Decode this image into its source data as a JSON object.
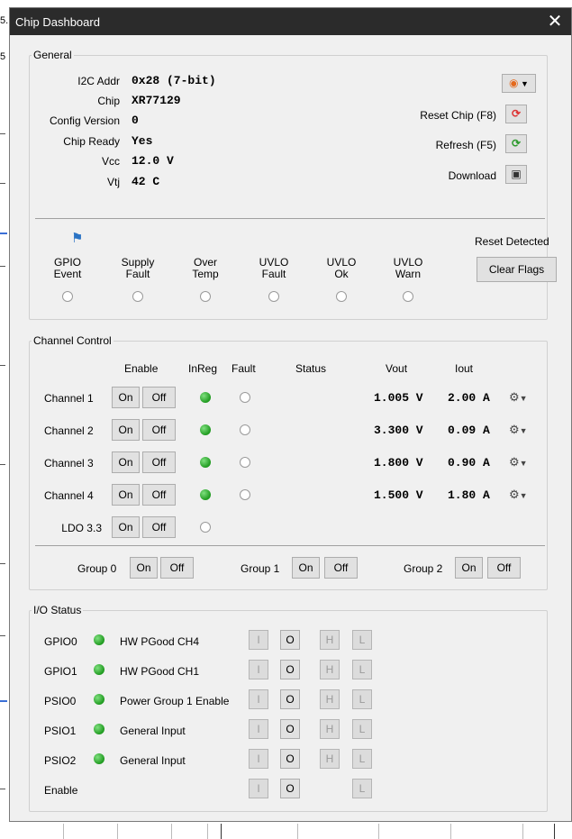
{
  "window": {
    "title": "Chip Dashboard"
  },
  "general": {
    "legend": "General",
    "fields": [
      {
        "label": "I2C Addr",
        "value": "0x28 (7-bit)"
      },
      {
        "label": "Chip",
        "value": "XR77129"
      },
      {
        "label": "Config Version",
        "value": "0"
      },
      {
        "label": "Chip Ready",
        "value": "Yes"
      },
      {
        "label": "Vcc",
        "value": "12.0 V"
      },
      {
        "label": "Vtj",
        "value": "42 C"
      }
    ],
    "reset_chip_label": "Reset Chip (F8)",
    "refresh_label": "Refresh (F5)",
    "download_label": "Download",
    "flags": [
      {
        "line1": "GPIO",
        "line2": "Event"
      },
      {
        "line1": "Supply",
        "line2": "Fault"
      },
      {
        "line1": "Over",
        "line2": "Temp"
      },
      {
        "line1": "UVLO",
        "line2": "Fault"
      },
      {
        "line1": "UVLO",
        "line2": "Ok"
      },
      {
        "line1": "UVLO",
        "line2": "Warn"
      }
    ],
    "reset_detected": "Reset Detected",
    "clear_flags": "Clear Flags"
  },
  "channel_control": {
    "legend": "Channel Control",
    "headers": {
      "enable": "Enable",
      "inreg": "InReg",
      "fault": "Fault",
      "status": "Status",
      "vout": "Vout",
      "iout": "Iout"
    },
    "on_label": "On",
    "off_label": "Off",
    "channels": [
      {
        "name": "Channel 1",
        "vout": "1.005 V",
        "iout": "2.00 A"
      },
      {
        "name": "Channel 2",
        "vout": "3.300 V",
        "iout": "0.09 A"
      },
      {
        "name": "Channel 3",
        "vout": "1.800 V",
        "iout": "0.90 A"
      },
      {
        "name": "Channel 4",
        "vout": "1.500 V",
        "iout": "1.80 A"
      }
    ],
    "ldo": {
      "name": "LDO 3.3"
    },
    "groups": [
      {
        "name": "Group 0"
      },
      {
        "name": "Group 1"
      },
      {
        "name": "Group 2"
      }
    ]
  },
  "io_status": {
    "legend": "I/O Status",
    "btn_labels": {
      "i": "I",
      "o": "O",
      "h": "H",
      "l": "L"
    },
    "rows": [
      {
        "name": "GPIO0",
        "desc": "HW PGood CH4"
      },
      {
        "name": "GPIO1",
        "desc": "HW PGood CH1"
      },
      {
        "name": "PSIO0",
        "desc": "Power Group 1 Enable"
      },
      {
        "name": "PSIO1",
        "desc": "General Input"
      },
      {
        "name": "PSIO2",
        "desc": "General Input"
      },
      {
        "name": "Enable",
        "desc": ""
      }
    ]
  },
  "background": {
    "left_marks": [
      "5.",
      "5"
    ]
  },
  "colors": {
    "titlebar": "#2b2b2b",
    "led_green": "#1f9a1f",
    "panel": "#f0f0f0"
  }
}
